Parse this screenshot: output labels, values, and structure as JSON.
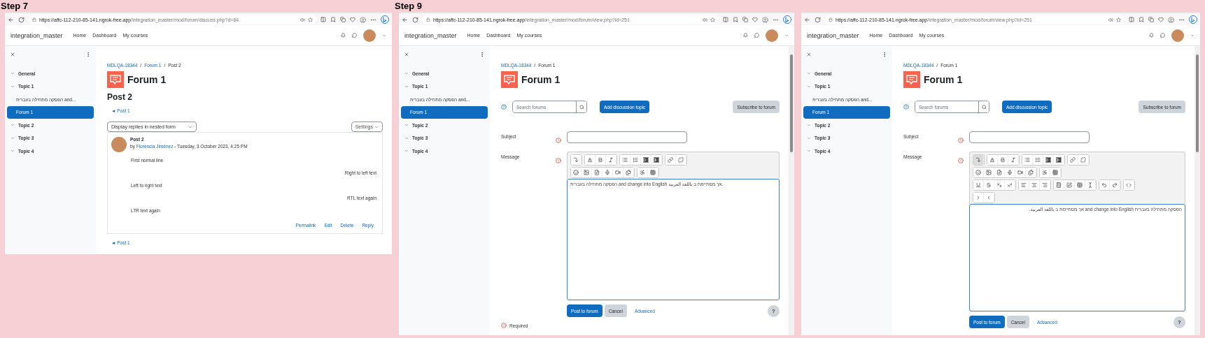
{
  "panels": [
    {
      "step": "Step 7",
      "browser": {
        "url_host": "https://affc-112-210-85-141.ngrok-free.app",
        "url_path": "/integration_master/mod/forum/discuss.php?d=64"
      },
      "site": {
        "name": "integration_master",
        "nav": [
          "Home",
          "Dashboard",
          "My courses"
        ]
      },
      "sidebar": [
        {
          "label": "General",
          "kind": "section",
          "selected": false
        },
        {
          "label": "Topic 1",
          "kind": "section",
          "selected": false
        },
        {
          "label": "הפסקה מתחילה בעברית and...",
          "kind": "activity",
          "selected": false
        },
        {
          "label": "Forum 1",
          "kind": "activity",
          "selected": true
        },
        {
          "label": "Topic 2",
          "kind": "section",
          "selected": false
        },
        {
          "label": "Topic 3",
          "kind": "section",
          "selected": false
        },
        {
          "label": "Topic 4",
          "kind": "section",
          "selected": false
        }
      ],
      "breadcrumb": [
        "MDLQA-18344",
        "Forum 1",
        "Post 2"
      ],
      "breadcrumb_separator": "/",
      "title": "Forum 1",
      "content": {
        "kind": "discussion",
        "heading": "Post 2",
        "prev_link": "◄ Post 1",
        "display_mode": "Display replies in nested form",
        "settings": "Settings",
        "post": {
          "title": "Post 2",
          "by": "by",
          "author": "Florencia Jiménez",
          "date": "- Tuesday, 3 October 2023, 4:25 PM",
          "lines": [
            {
              "text": "First normal line",
              "right_to_left": false
            },
            {
              "text": "Right to left text",
              "right_to_left": true
            },
            {
              "text": "Left to right text",
              "right_to_left": false
            },
            {
              "text": "RTL text again",
              "right_to_left": true
            },
            {
              "text": "LTR text again",
              "right_to_left": false
            }
          ],
          "actions": [
            "Permalink",
            "Edit",
            "Delete",
            "Reply"
          ]
        },
        "footer_link": "◄ Post 1"
      }
    },
    {
      "step": "Step 9",
      "browser": {
        "url_host": "https://affc-112-210-85-141.ngrok-free.app",
        "url_path": "/integration_master/mod/forum/view.php?id=251"
      },
      "site": {
        "name": "integration_master",
        "nav": [
          "Home",
          "Dashboard",
          "My courses"
        ]
      },
      "sidebar": [
        {
          "label": "General",
          "kind": "section",
          "selected": false
        },
        {
          "label": "Topic 1",
          "kind": "section",
          "selected": false
        },
        {
          "label": "הפסקה מתחילה בעברית and...",
          "kind": "activity",
          "selected": false
        },
        {
          "label": "Forum 1",
          "kind": "activity",
          "selected": true
        },
        {
          "label": "Topic 2",
          "kind": "section",
          "selected": false
        },
        {
          "label": "Topic 3",
          "kind": "section",
          "selected": false
        },
        {
          "label": "Topic 4",
          "kind": "section",
          "selected": false
        }
      ],
      "breadcrumb": [
        "MDLQA-18344",
        "Forum 1"
      ],
      "breadcrumb_separator": "/",
      "title": "Forum 1",
      "content": {
        "kind": "form",
        "search_placeholder": "Search forums",
        "add_button": "Add discussion topic",
        "subscribe_button": "Subscribe to forum",
        "subject_label": "Subject",
        "message_label": "Message",
        "toolbar_expanded": false,
        "message": "הפסקה מתחילה בעברית and change into English אך מסתיימת ב باللغة العربية.",
        "right_to_left": false,
        "submit": "Post to forum",
        "cancel": "Cancel",
        "advanced": "Advanced",
        "help": "?",
        "required_note": "Required"
      }
    },
    {
      "browser": {
        "url_host": "https://affc-112-210-85-141.ngrok-free.app",
        "url_path": "/integration_master/mod/forum/view.php?id=251"
      },
      "site": {
        "name": "integration_master",
        "nav": [
          "Home",
          "Dashboard",
          "My courses"
        ]
      },
      "sidebar": [
        {
          "label": "General",
          "kind": "section",
          "selected": false
        },
        {
          "label": "Topic 1",
          "kind": "section",
          "selected": false
        },
        {
          "label": "הפסקה מתחילה בעברית and...",
          "kind": "activity",
          "selected": false
        },
        {
          "label": "Forum 1",
          "kind": "activity",
          "selected": true
        },
        {
          "label": "Topic 2",
          "kind": "section",
          "selected": false
        },
        {
          "label": "Topic 3",
          "kind": "section",
          "selected": false
        },
        {
          "label": "Topic 4",
          "kind": "section",
          "selected": false
        }
      ],
      "breadcrumb": [
        "MDLQA-18344",
        "Forum 1"
      ],
      "breadcrumb_separator": "/",
      "title": "Forum 1",
      "content": {
        "kind": "form",
        "search_placeholder": "Search forums",
        "add_button": "Add discussion topic",
        "subscribe_button": "Subscribe to forum",
        "subject_label": "Subject",
        "message_label": "Message",
        "toolbar_expanded": true,
        "message": "הפסקה מתחילה בעברית and change into English אך מסתיימת ב باللغة العربية.",
        "right_to_left": true,
        "submit": "Post to forum",
        "cancel": "Cancel",
        "advanced": "Advanced",
        "help": "?"
      }
    }
  ]
}
